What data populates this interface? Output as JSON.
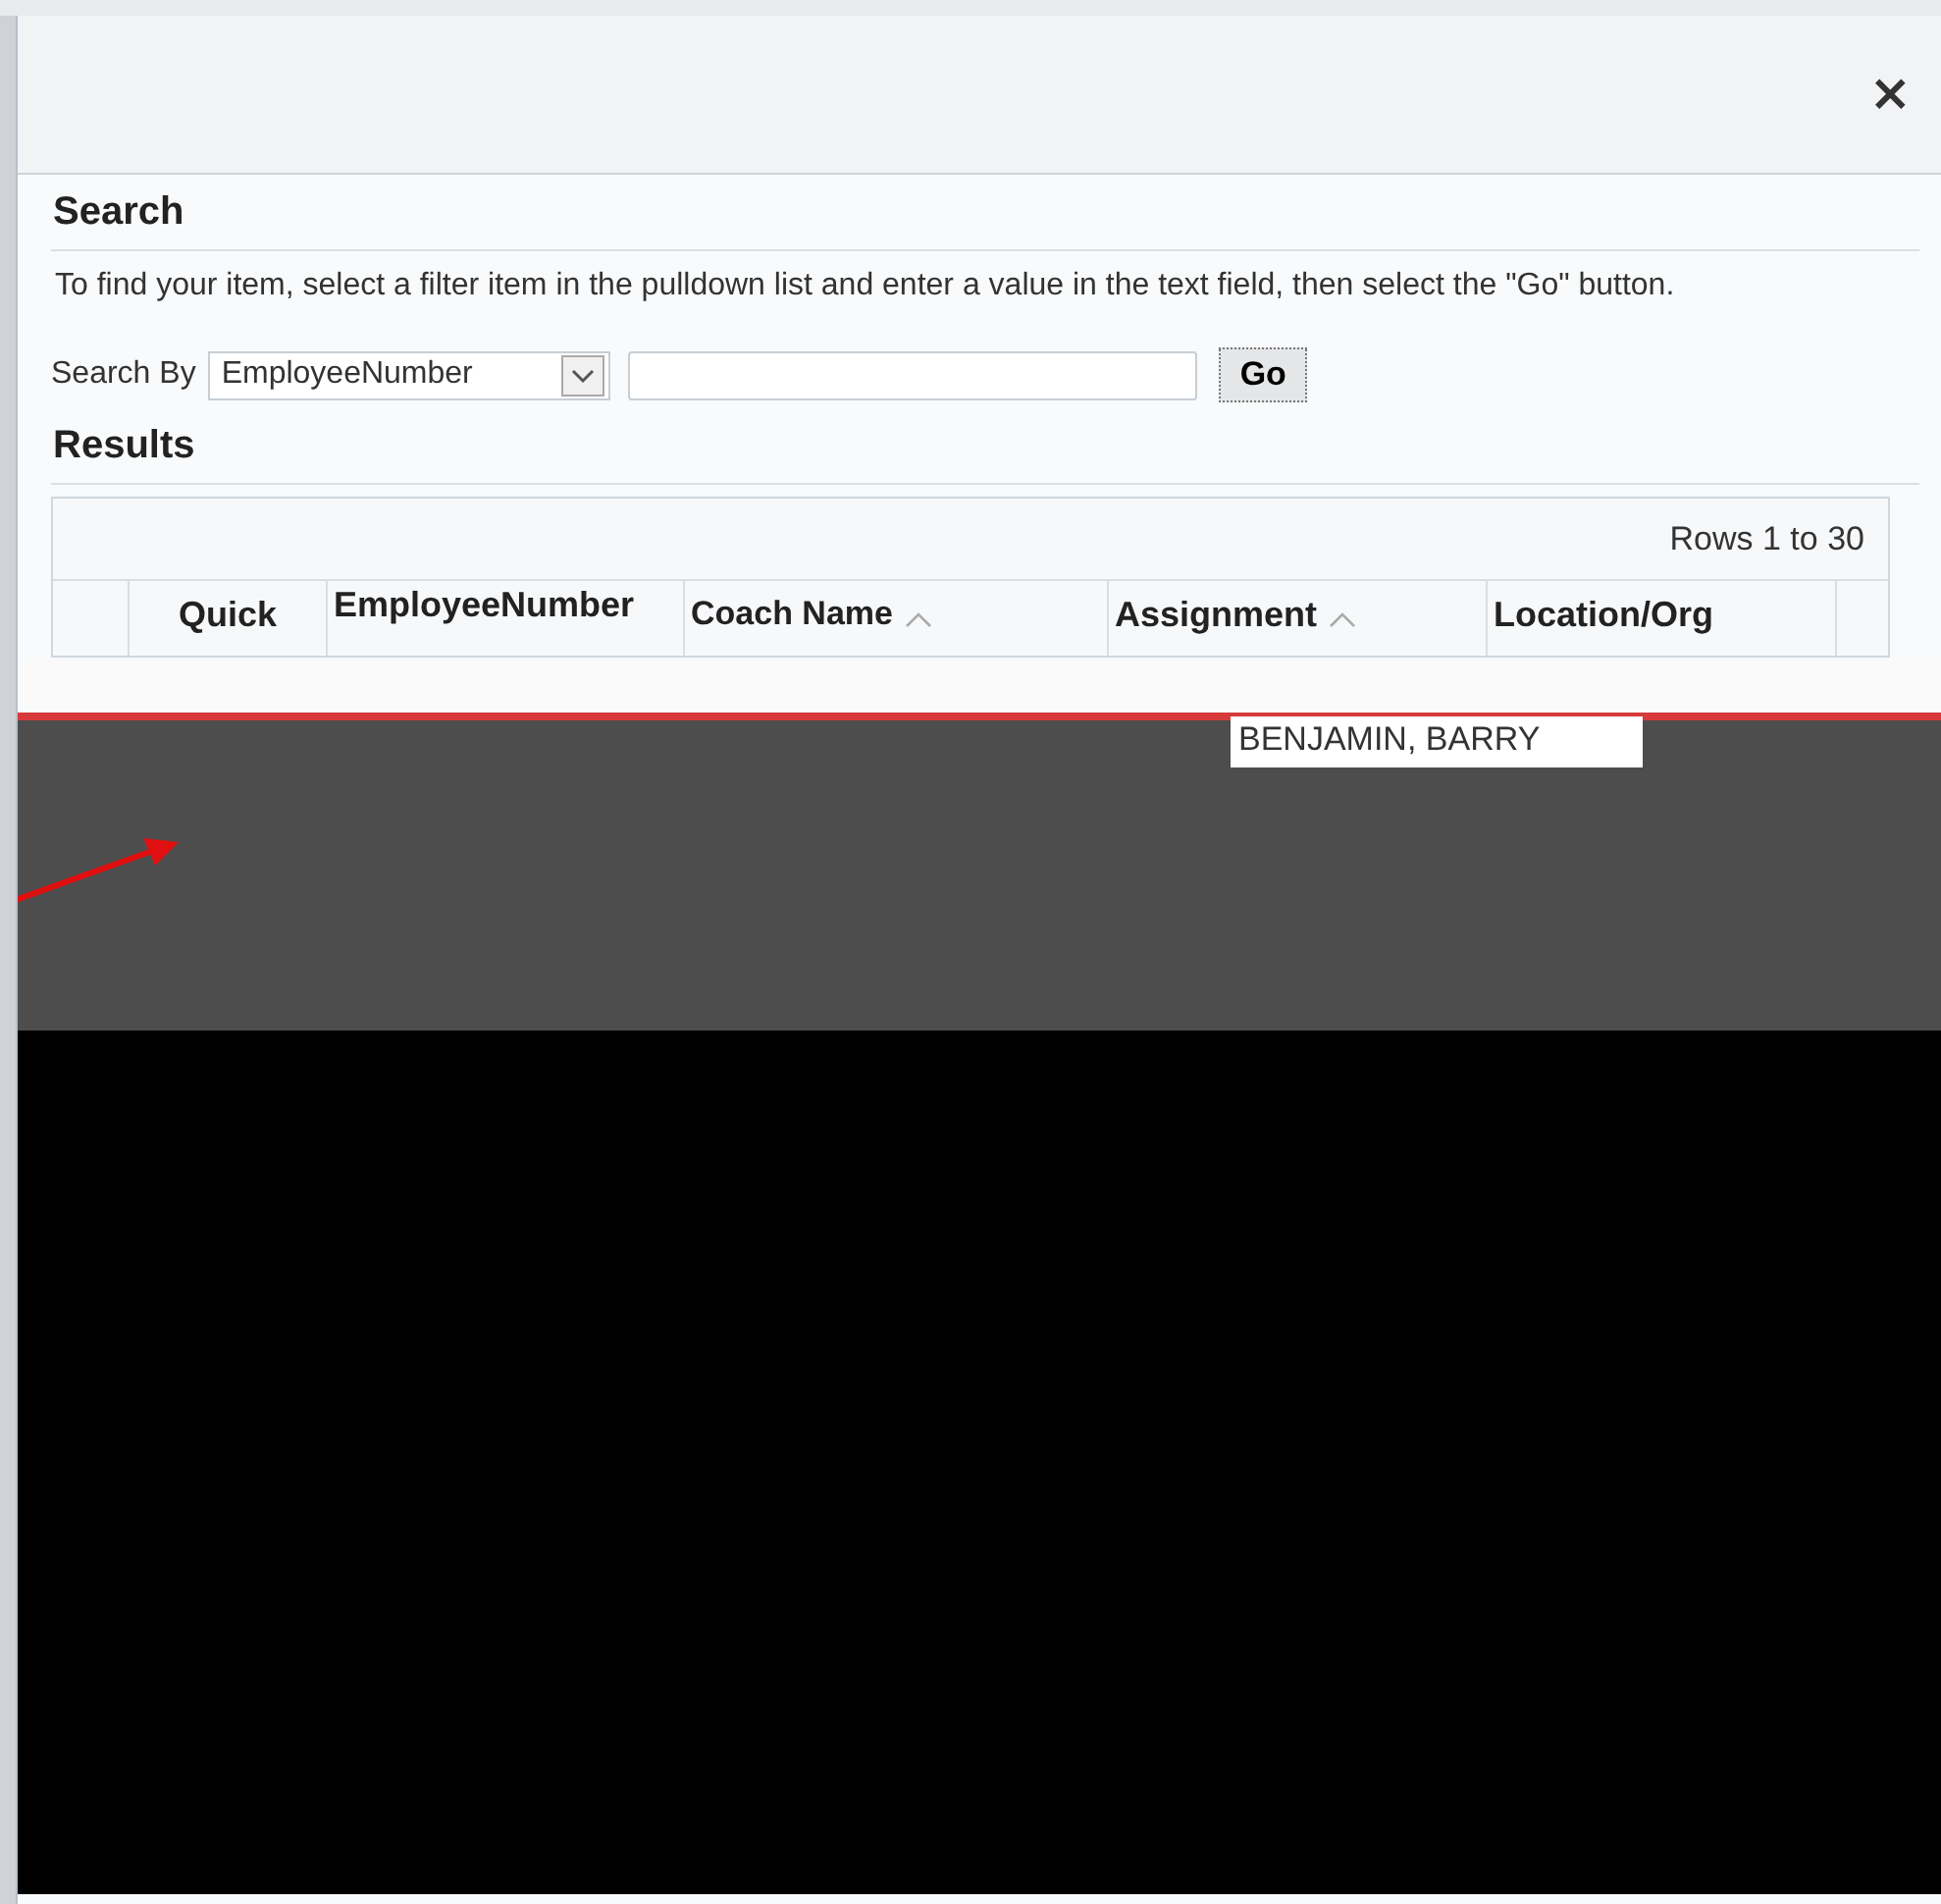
{
  "dialog": {
    "close": "×"
  },
  "search": {
    "title": "Search",
    "instructions": "To find your item, select a filter item in the pulldown list and enter a value in the text field, then select the \"Go\" button.",
    "label": "Search By",
    "filter": "EmployeeNumber",
    "go": "Go"
  },
  "results": {
    "title": "Results",
    "range": "Rows 1 to 30",
    "columns": [
      {
        "label": "Quick",
        "sortable": false
      },
      {
        "label": "EmployeeNumber",
        "sortable": false
      },
      {
        "label": "Coach Name",
        "sortable": true
      },
      {
        "label": "Assignment",
        "sortable": true
      },
      {
        "label": "Location/Org",
        "sortable": false
      }
    ],
    "visible_cell": "BENJAMIN, BARRY"
  }
}
